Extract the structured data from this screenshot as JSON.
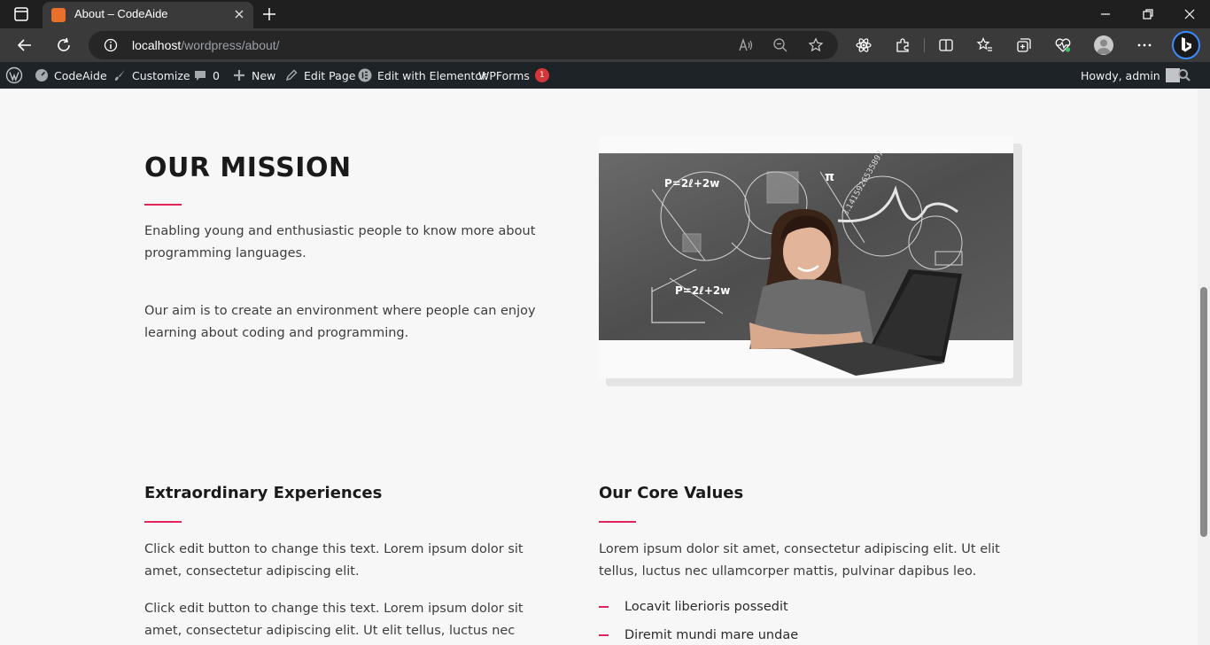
{
  "browser": {
    "tab_title": "About – CodeAide",
    "url_host": "localhost",
    "url_path": "/wordpress/about/"
  },
  "admin_bar": {
    "site_name": "CodeAide",
    "customize": "Customize",
    "comments_count": "0",
    "new": "New",
    "edit_page": "Edit Page",
    "edit_elementor": "Edit with Elementor",
    "wpforms": "WPForms",
    "wpforms_badge": "1",
    "howdy": "Howdy, admin"
  },
  "mission": {
    "title": "OUR MISSION",
    "para1_line1": "Enabling young and enthusiastic people to know more about",
    "para1_line2": "programming languages.",
    "para2_line1": "Our aim is to create an environment where people can enjoy",
    "para2_line2": "learning about coding and programming."
  },
  "experiences": {
    "title": "Extraordinary Experiences",
    "p1_line1": "Click edit button to change this text. Lorem ipsum dolor sit",
    "p1_line2": "amet, consectetur adipiscing elit.",
    "p2_line1": "Click edit button to change this text. Lorem ipsum dolor sit",
    "p2_line2": "amet, consectetur adipiscing elit. Ut elit tellus, luctus nec"
  },
  "core_values": {
    "title": "Our Core Values",
    "p_line1": "Lorem ipsum dolor sit amet, consectetur adipiscing elit. Ut elit",
    "p_line2": "tellus, luctus nec ullamcorper mattis, pulvinar dapibus leo.",
    "items": [
      "Locavit liberioris possedit",
      "Diremit mundi mare undae"
    ]
  },
  "colors": {
    "accent": "#e2245c",
    "admin_bar_bg": "#1d2327",
    "badge": "#d63638"
  }
}
